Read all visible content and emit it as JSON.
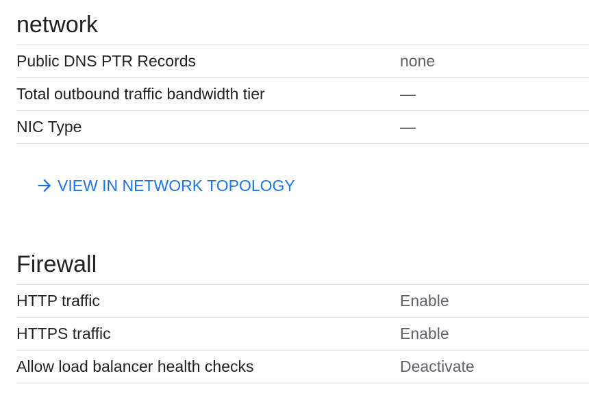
{
  "network": {
    "title": "network",
    "rows": [
      {
        "label": "Public DNS PTR Records",
        "value": "none"
      },
      {
        "label": "Total outbound traffic bandwidth tier",
        "value": "—"
      },
      {
        "label": "NIC Type",
        "value": "—"
      }
    ],
    "topology_link": "VIEW IN NETWORK TOPOLOGY",
    "link_icon": "arrow-right-icon",
    "link_color": "#1a73e8"
  },
  "firewall": {
    "title": "Firewall",
    "rows": [
      {
        "label": "HTTP traffic",
        "value": "Enable"
      },
      {
        "label": "HTTPS traffic",
        "value": "Enable"
      },
      {
        "label": "Allow load balancer health checks",
        "value": "Deactivate"
      }
    ]
  }
}
